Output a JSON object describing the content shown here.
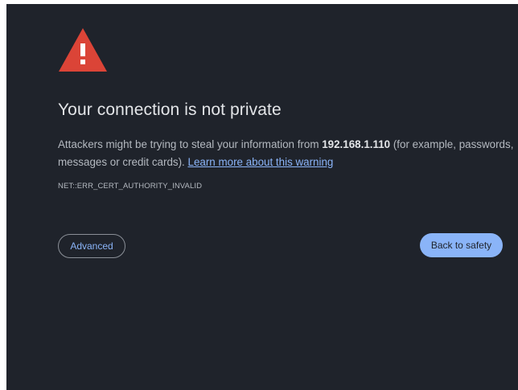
{
  "page": {
    "title": "Your connection is not private",
    "message_before_host": "Attackers might be trying to steal your information from ",
    "host": "192.168.1.110",
    "message_after_host": " (for example, passwords, messages or credit cards). ",
    "learn_more_link": "Learn more about this warning",
    "error_code": "NET::ERR_CERT_AUTHORITY_INVALID"
  },
  "buttons": {
    "advanced_label": "Advanced",
    "back_to_safety_label": "Back to safety"
  },
  "icons": {
    "warning": "warning-triangle-icon"
  },
  "colors": {
    "background": "#1f232b",
    "warning_red": "#db4437",
    "link_blue": "#8ab4f8",
    "title_text": "#e3e5e8",
    "body_text": "#b4b9c0"
  }
}
